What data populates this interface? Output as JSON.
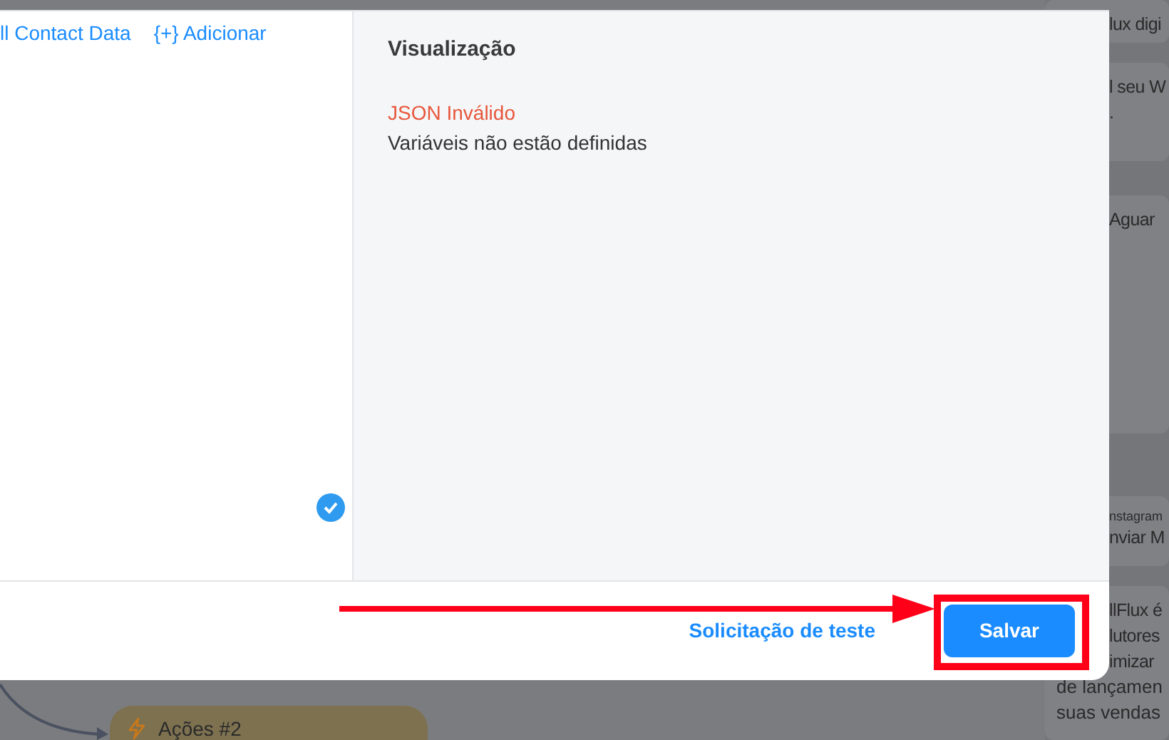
{
  "dialog": {
    "variables": [
      "ll Contact Data",
      "{+} Adicionar"
    ],
    "preview": {
      "title": "Visualização",
      "error": "JSON Inválido",
      "message": "Variáveis não estão definidas"
    },
    "footer": {
      "test_link": "Solicitação de teste",
      "save_button": "Salvar"
    }
  },
  "background": {
    "cards": [
      {
        "lines_beside": [
          "lux digi"
        ]
      },
      {
        "lines_beside": [
          "l seu W",
          "."
        ]
      },
      {
        "lines_beside": [
          "Aguar"
        ]
      },
      {
        "caption": "nstagram",
        "lines_beside": [
          "nviar M"
        ]
      },
      {
        "lines_beside": [
          "llFlux é",
          "lutores",
          "imizar"
        ],
        "lines_below": [
          "de lançamen",
          "suas vendas"
        ]
      }
    ],
    "node": {
      "label": "Ações #2"
    }
  }
}
